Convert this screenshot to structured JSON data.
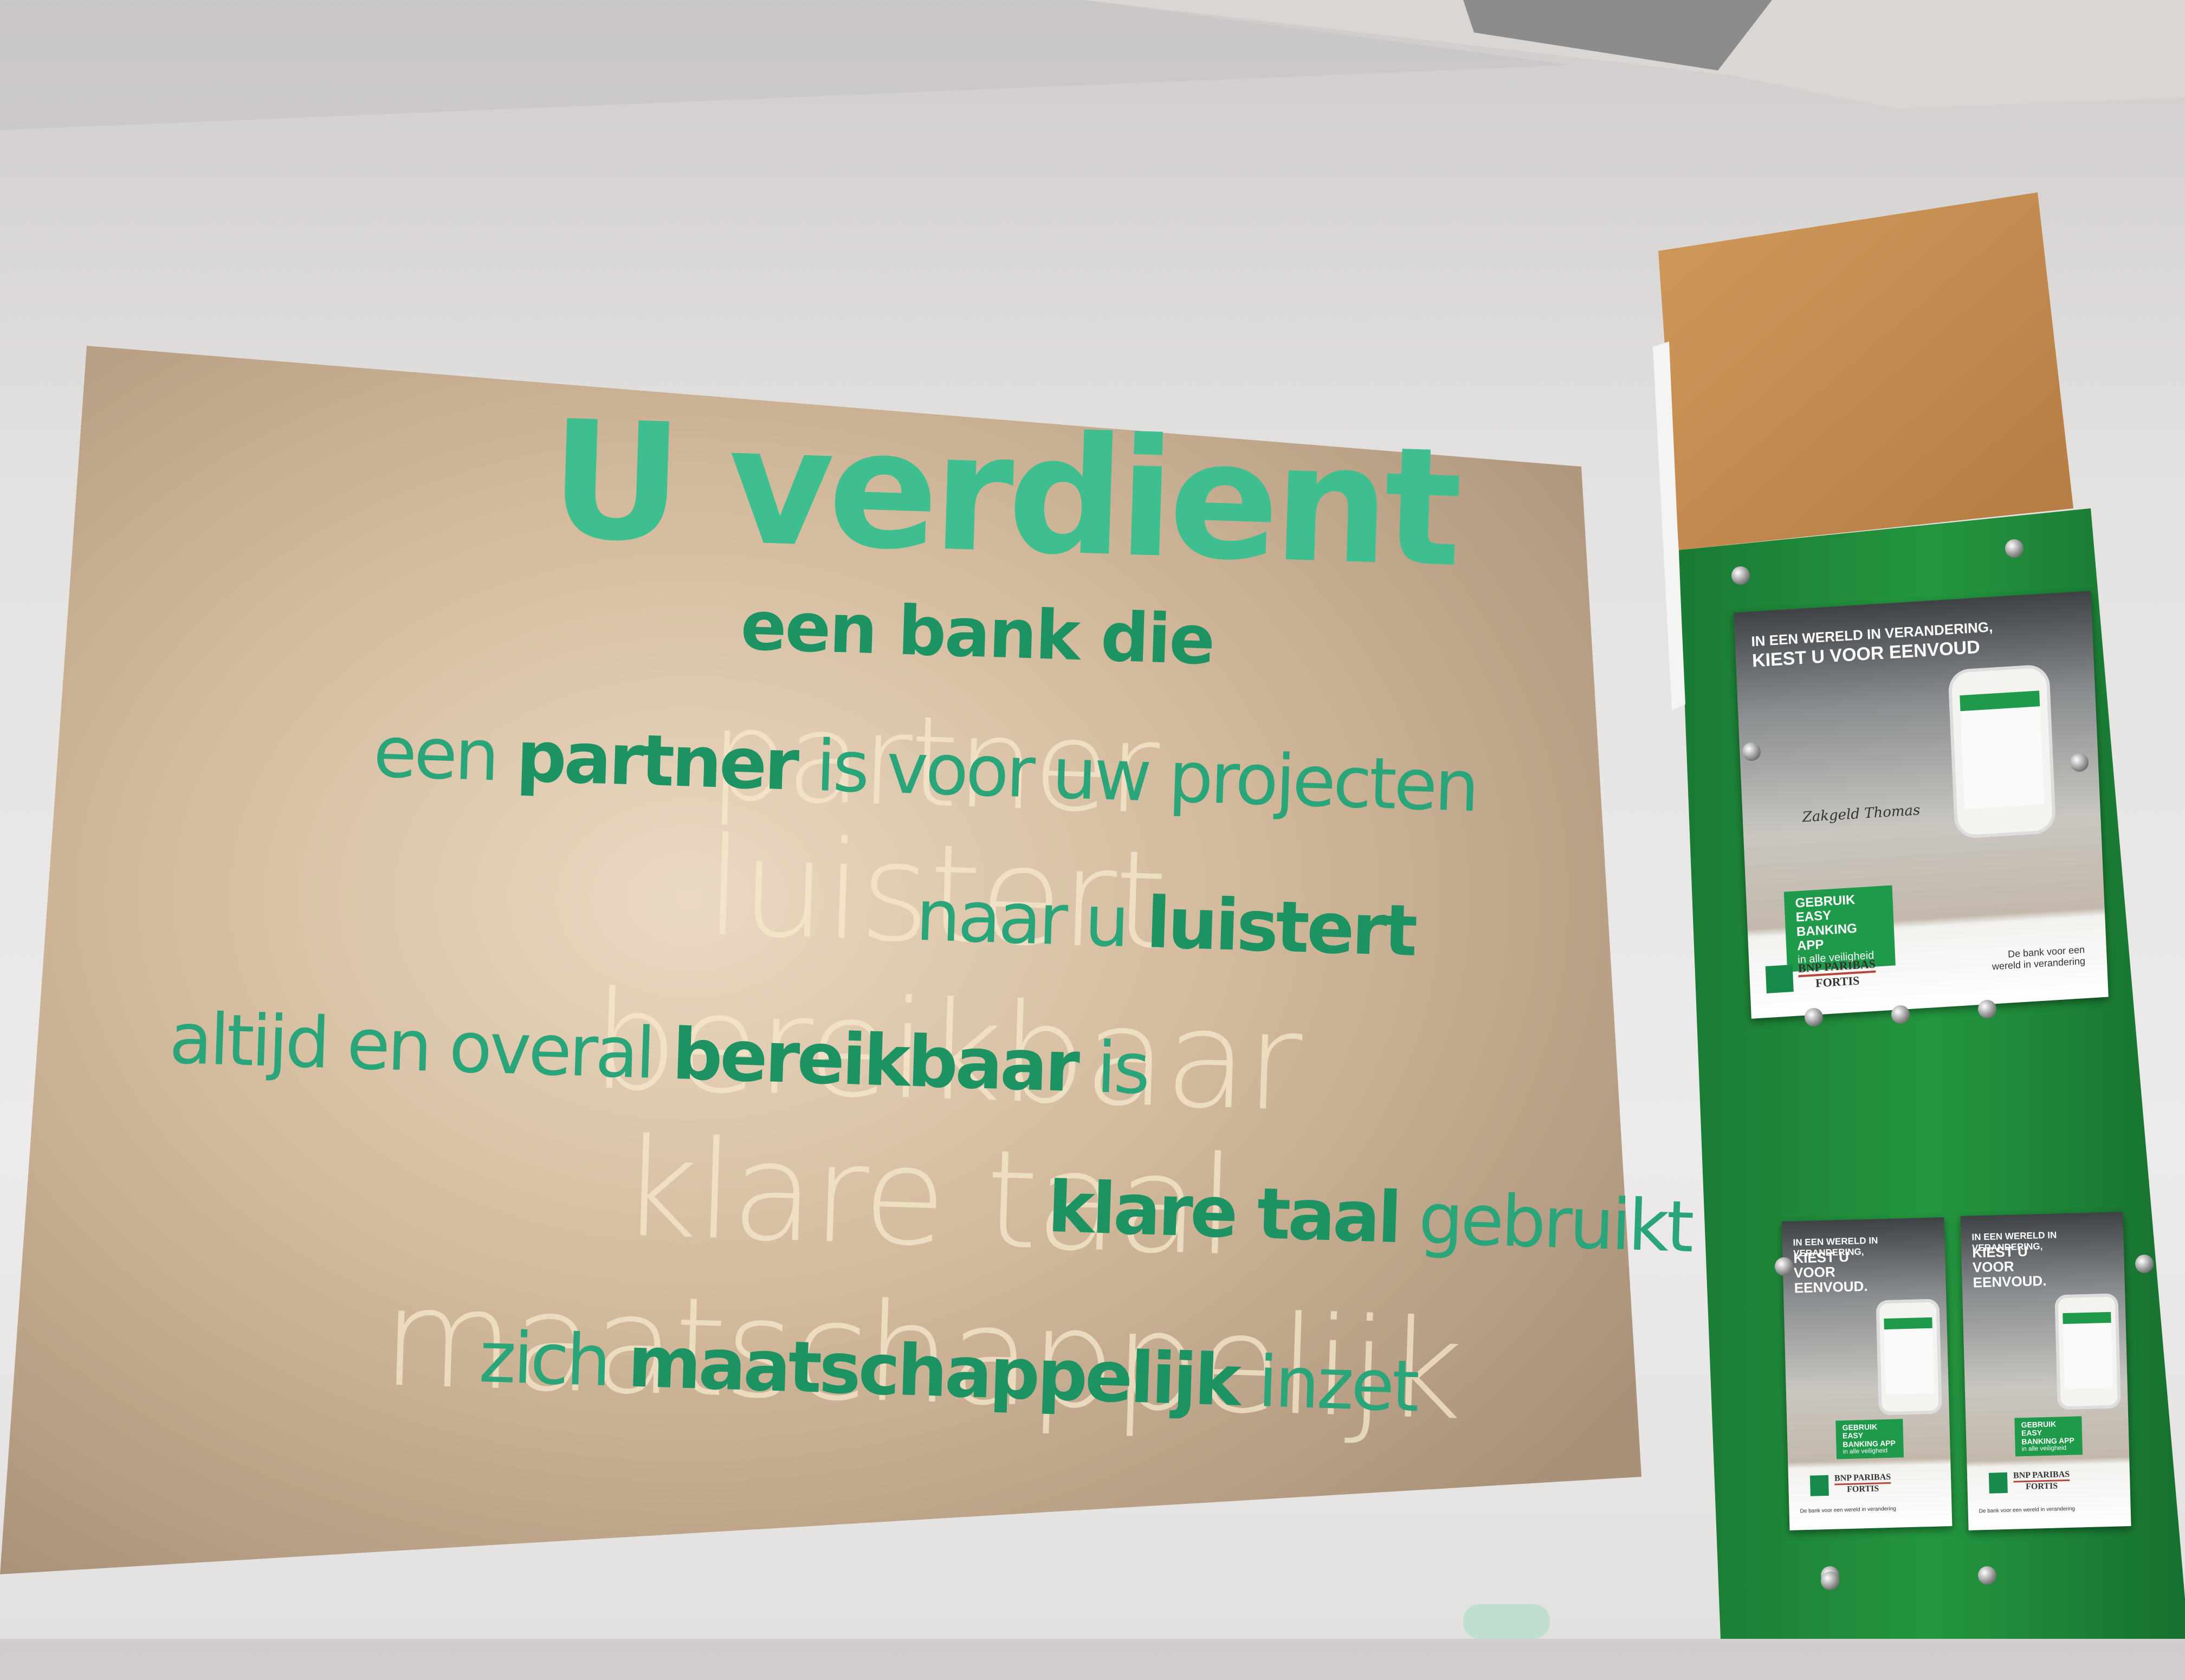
{
  "sign": {
    "headline": "U verdient",
    "subline": "een bank die",
    "lines": [
      {
        "pre": "een ",
        "bold": "partner",
        "post": " is voor uw projecten",
        "ghost": "partner"
      },
      {
        "pre": "naar u ",
        "bold": "luistert",
        "post": "",
        "ghost": "luistert"
      },
      {
        "pre": "altijd en overal ",
        "bold": "bereikbaar",
        "post": " is",
        "ghost": "bereikbaar"
      },
      {
        "pre": "",
        "bold": "klare taal",
        "post": " gebruikt",
        "ghost": "klare taal"
      },
      {
        "pre": "zich ",
        "bold": "maatschappelijk",
        "post": " inzet",
        "ghost": "maatschappelijk"
      }
    ],
    "colors": {
      "board": "#c8ad90",
      "text": "#2aa57a",
      "bold_text": "#1d9364"
    }
  },
  "brochures": {
    "large": {
      "heading_top": "IN EEN WERELD IN VERANDERING,",
      "heading_main": "KIEST U VOOR EENVOUD",
      "handwriting": "Zakgeld Thomas",
      "cta_main": "GEBRUIK EASY BANKING APP",
      "cta_sub": "in alle veiligheid",
      "brand_1": "BNP PARIBAS",
      "brand_2": "FORTIS",
      "tagline": "De bank voor een wereld in verandering"
    },
    "small": {
      "heading_top": "IN EEN WERELD IN VERANDERING,",
      "heading_main": "KIEST U VOOR EENVOUD.",
      "cta_main": "GEBRUIK EASY BANKING APP",
      "cta_sub": "in alle veiligheid",
      "brand_1": "BNP PARIBAS",
      "brand_2": "FORTIS",
      "tagline": "De bank voor een wereld in verandering"
    },
    "colors": {
      "rack": "#1f8a3c",
      "brand_green": "#1f9a4b",
      "wood": "#c08a52"
    }
  }
}
